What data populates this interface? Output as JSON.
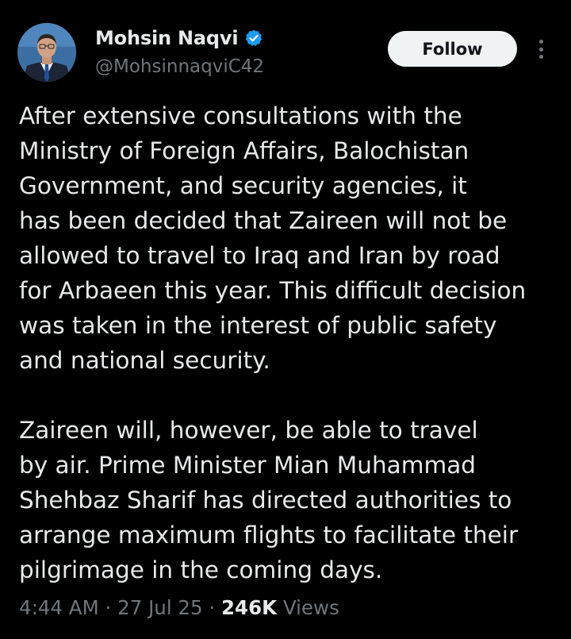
{
  "author": {
    "name": "Mohsin Naqvi",
    "handle": "@MohsinnaqviC42",
    "verified": true
  },
  "actions": {
    "follow_label": "Follow"
  },
  "tweet": {
    "paragraph1": [
      "After extensive consultations with the",
      "Ministry of Foreign Affairs, Balochistan",
      "Government, and security agencies, it",
      "has been decided that Zaireen will not be",
      "allowed to travel to Iraq and Iran by road",
      "for Arbaeen this year. This difficult decision",
      "was taken in the interest of public safety",
      "and national security."
    ],
    "paragraph2": [
      "Zaireen will, however, be able to travel",
      "by air. Prime Minister Mian Muhammad",
      "Shehbaz Sharif has directed authorities to",
      "arrange maximum flights to facilitate their",
      "pilgrimage in the coming days."
    ]
  },
  "meta": {
    "time": "4:44 AM",
    "separator": "·",
    "date": "27 Jul 25",
    "views_count": "246K",
    "views_label": "Views"
  },
  "colors": {
    "background": "#000000",
    "text_primary": "#e7e9ea",
    "text_secondary": "#71767b",
    "verified_blue": "#1d9bf0",
    "follow_bg": "#eff3f4"
  },
  "icons": {
    "verified": "verified-badge-icon",
    "more": "more-options-icon"
  }
}
